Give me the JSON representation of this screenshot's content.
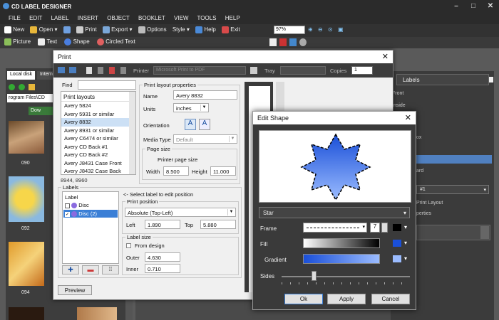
{
  "app": {
    "title": "CD LABEL DESIGNER",
    "menu": [
      "FILE",
      "EDIT",
      "LABEL",
      "INSERT",
      "OBJECT",
      "BOOKLET",
      "VIEW",
      "TOOLS",
      "HELP"
    ],
    "toolbar1": [
      "New",
      "Open",
      "Print",
      "Export",
      "Options",
      "Style",
      "Help",
      "Exit"
    ],
    "toolbar2": [
      "Picture",
      "Text",
      "Shape",
      "Circled Text"
    ],
    "zoom": "97%"
  },
  "left_panel": {
    "tabs": [
      "Local disk",
      "Intern"
    ],
    "path": "rogram Files\\CD",
    "down_button": "Dow",
    "thumbs": [
      "090",
      "092",
      "094"
    ]
  },
  "right_panel": {
    "header": "Labels",
    "items": [
      "Front",
      "Inside",
      "ox",
      "ard",
      "#1",
      "Print Layout",
      "perties"
    ]
  },
  "print_dialog": {
    "title": "Print",
    "printer_label": "Printer",
    "printer_value": "Microsoft Print to PDF",
    "tray_label": "Tray",
    "copies_label": "Copies",
    "copies_value": "1",
    "find_label": "Find",
    "layouts_header": "Print layouts",
    "layouts": [
      "Avery 5824",
      "Avery 5931 or similar",
      "Avery 8832",
      "Avery 8931 or similar",
      "Avery C6474 or similar",
      "Avery CD Back #1",
      "Avery CD Back #2",
      "Avery J8431 Case Front",
      "Avery J8432 Case Back"
    ],
    "layouts_status": "8944, 8960",
    "props_title": "Print layout properties",
    "name_label": "Name",
    "name_value": "Avery 8832",
    "units_label": "Units",
    "units_value": "inches",
    "orientation_label": "Orientation",
    "media_type_label": "Media Type",
    "media_type_value": "Default",
    "page_size_title": "Page size",
    "page_size_value": "Printer page size",
    "width_label": "Width",
    "width_value": "8.500",
    "height_label": "Height",
    "height_value": "11.000",
    "labels_title": "Labels",
    "label_col": "Label",
    "label_items": [
      "Disc",
      "Disc (2)"
    ],
    "select_hint": "<- Select label to edit position",
    "print_position_title": "Print position",
    "position_mode": "Absolute (Top-Left)",
    "left_label": "Left",
    "left_value": "1.890",
    "top_label": "Top",
    "top_value": "5.880",
    "label_size_title": "Label size",
    "from_design": "From design",
    "outer_label": "Outer",
    "outer_value": "4.630",
    "inner_label": "Inner",
    "inner_value": "0.710",
    "preview_button": "Preview"
  },
  "shape_dialog": {
    "title": "Edit Shape",
    "shape_value": "Star",
    "frame_label": "Frame",
    "frame_width": "7",
    "fill_label": "Fill",
    "gradient_label": "Gradient",
    "sides_label": "Sides",
    "ok": "Ok",
    "apply": "Apply",
    "cancel": "Cancel",
    "star_color_top": "#1a4fd8",
    "star_color_bottom": "#9bbcff"
  }
}
